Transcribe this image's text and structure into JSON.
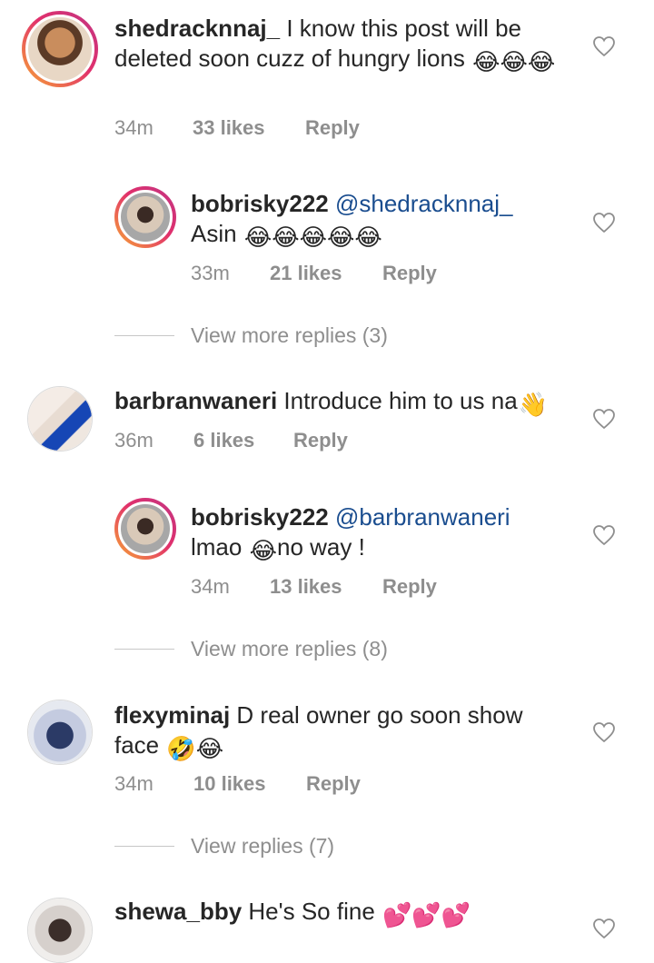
{
  "comments": [
    {
      "username": "shedracknnaj_",
      "text": "I know this post will be deleted soon cuzz of hungry lions",
      "emoji": "😂😂😂",
      "time": "34m",
      "likes": "33 likes",
      "reply": "Reply",
      "avatar_icon": "avatar-photo"
    },
    {
      "username": "bobrisky222",
      "mention": "@shedracknnaj_",
      "text": "Asin",
      "emoji": "😂😂😂😂😂",
      "time": "33m",
      "likes": "21 likes",
      "reply": "Reply"
    },
    {
      "username": "barbranwaneri",
      "text": "Introduce him to us na",
      "emoji": "👋",
      "time": "36m",
      "likes": "6 likes",
      "reply": "Reply"
    },
    {
      "username": "bobrisky222",
      "mention": "@barbranwaneri",
      "text": "lmao",
      "emoji": "😂",
      "text_after": "no way !",
      "time": "34m",
      "likes": "13 likes",
      "reply": "Reply"
    },
    {
      "username": "flexyminaj",
      "text": "D real owner go soon show face",
      "emoji": "🤣😂",
      "time": "34m",
      "likes": "10 likes",
      "reply": "Reply"
    },
    {
      "username": "shewa_bby",
      "text": "He's So fine",
      "emoji": "💕💕💕"
    }
  ],
  "view_more": [
    "View more replies (3)",
    "View more replies (8)",
    "View replies (7)"
  ],
  "colors": {
    "mention": "#1a4d8f",
    "meta": "#8e8e8e",
    "story_ring": "#e1306c"
  }
}
